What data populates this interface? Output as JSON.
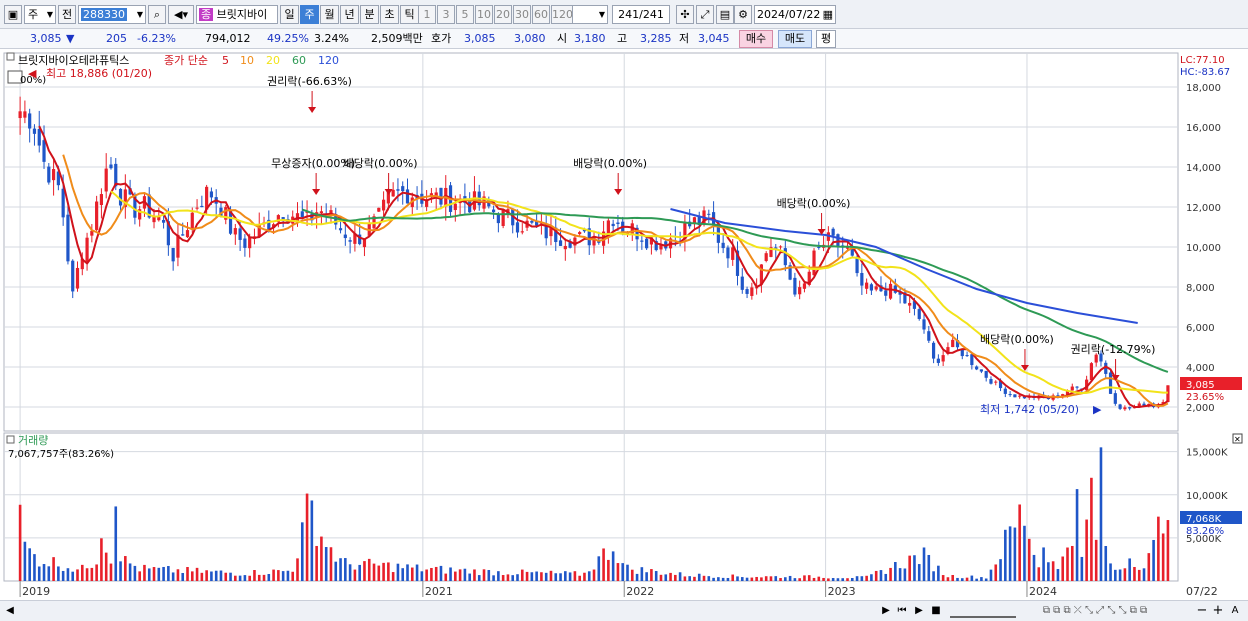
{
  "toolbar": {
    "market_label": "주",
    "prev_label": "전",
    "code": "288330",
    "stock_name": "브릿지바이",
    "periods": [
      "일",
      "주",
      "월",
      "년",
      "분",
      "초",
      "틱"
    ],
    "selected_period": "주",
    "intervals": [
      "1",
      "3",
      "5",
      "10",
      "20",
      "30",
      "60",
      "120"
    ],
    "count": "241",
    "count_total": "/241",
    "date": "2024/07/22"
  },
  "quote": {
    "price": "3,085",
    "change_arrow": "▼",
    "change": "205",
    "change_pct": "-6.23%",
    "volume": "794,012",
    "turnover_pct": "49.25%",
    "ratio": "3.24%",
    "amount": "2,509백만",
    "bid_label": "호가",
    "bid": "3,085",
    "ask": "3,080",
    "open_label": "시",
    "open": "3,180",
    "high_label": "고",
    "high": "3,285",
    "low_label": "저",
    "low": "3,045",
    "buy_button": "매수",
    "sell_button": "매도",
    "flat_button": "평"
  },
  "price_panel": {
    "stock_title": "브릿지바이오테라퓨틱스",
    "ma_title": "종가 단순",
    "ma_periods": [
      "5",
      "10",
      "20",
      "60",
      "120"
    ],
    "ma_colors": [
      "#d0121b",
      "#f08c1a",
      "#f2e31a",
      "#2e9a55",
      "#2b4fd8"
    ],
    "lc": "LC:77.10",
    "hc": "HC:-83.67",
    "high_label": "최고 18,886 (01/20)",
    "low_label": "최저 1,742 (05/20)",
    "current_price": "3,085",
    "current_pct": "23.65%",
    "partial_label": "00%)",
    "y_ticks": [
      "18,000",
      "16,000",
      "14,000",
      "12,000",
      "10,000",
      "8,000",
      "6,000",
      "4,000",
      "2,000"
    ],
    "events": [
      {
        "label": "권리락(-66.63%)",
        "date": "2020.45",
        "y": 16500
      },
      {
        "label": "무상증자(0.00%)",
        "date": "2020.47",
        "y": 12400
      },
      {
        "label": "배당락(0.00%)",
        "date": "2020.83",
        "y": 12400
      },
      {
        "label": "배당락(0.00%)",
        "date": "2021.97",
        "y": 12400
      },
      {
        "label": "배당락(0.00%)",
        "date": "2022.98",
        "y": 10400
      },
      {
        "label": "배당락(0.00%)",
        "date": "2023.99",
        "y": 3600
      },
      {
        "label": "권리락(-12.79%)",
        "date": "2024.44",
        "y": 3100
      }
    ]
  },
  "volume_panel": {
    "title": "거래량",
    "top_value": "7,067,757주(83.26%)",
    "current": "7,068K",
    "current_pct": "83.26%",
    "y_ticks": [
      "15,000K",
      "10,000K",
      "5,000K"
    ]
  },
  "x_axis": {
    "labels": [
      "2019",
      "2021",
      "2022",
      "2023",
      "2024",
      "07/22"
    ]
  },
  "chart_data": {
    "type": "candlestick",
    "interval": "weekly",
    "x_labels": [
      "2019",
      "2021",
      "2022",
      "2023",
      "2024",
      "07/22"
    ],
    "y_ticks": [
      18000,
      16000,
      14000,
      12000,
      10000,
      8000,
      6000,
      4000,
      2000
    ],
    "ylim": [
      1000,
      19500
    ],
    "ma": [
      5,
      10,
      20,
      60,
      120
    ],
    "annotations": [
      "최고 18,886 (01/20)",
      "최저 1,742 (05/20)"
    ],
    "close_anchors": [
      [
        2019.0,
        16800
      ],
      [
        2019.06,
        16500
      ],
      [
        2019.12,
        14200
      ],
      [
        2019.2,
        12800
      ],
      [
        2019.26,
        7500
      ],
      [
        2019.3,
        9600
      ],
      [
        2019.36,
        11200
      ],
      [
        2019.42,
        13800
      ],
      [
        2019.46,
        14000
      ],
      [
        2019.5,
        12600
      ],
      [
        2019.56,
        11900
      ],
      [
        2019.62,
        12000
      ],
      [
        2019.7,
        11400
      ],
      [
        2019.76,
        9600
      ],
      [
        2019.82,
        10900
      ],
      [
        2019.88,
        12200
      ],
      [
        2019.94,
        12800
      ],
      [
        2020.0,
        12000
      ],
      [
        2020.06,
        10600
      ],
      [
        2020.12,
        10200
      ],
      [
        2020.18,
        10800
      ],
      [
        2020.24,
        11300
      ],
      [
        2020.3,
        11800
      ],
      [
        2020.36,
        11600
      ],
      [
        2020.42,
        11200
      ],
      [
        2020.48,
        11900
      ],
      [
        2020.54,
        11500
      ],
      [
        2020.6,
        10800
      ],
      [
        2020.66,
        10400
      ],
      [
        2020.72,
        10700
      ],
      [
        2020.78,
        11400
      ],
      [
        2020.84,
        12500
      ],
      [
        2020.92,
        12800
      ],
      [
        2021.0,
        12500
      ],
      [
        2021.1,
        12400
      ],
      [
        2021.2,
        12300
      ],
      [
        2021.3,
        12100
      ],
      [
        2021.38,
        11600
      ],
      [
        2021.46,
        11300
      ],
      [
        2021.54,
        11000
      ],
      [
        2021.62,
        10700
      ],
      [
        2021.7,
        10500
      ],
      [
        2021.78,
        10400
      ],
      [
        2021.86,
        10500
      ],
      [
        2021.94,
        11600
      ],
      [
        2022.0,
        11000
      ],
      [
        2022.06,
        10800
      ],
      [
        2022.12,
        10400
      ],
      [
        2022.18,
        10200
      ],
      [
        2022.26,
        10600
      ],
      [
        2022.34,
        11200
      ],
      [
        2022.42,
        11400
      ],
      [
        2022.48,
        10200
      ],
      [
        2022.54,
        9600
      ],
      [
        2022.6,
        7800
      ],
      [
        2022.66,
        8400
      ],
      [
        2022.72,
        10200
      ],
      [
        2022.78,
        9600
      ],
      [
        2022.84,
        8000
      ],
      [
        2022.88,
        7600
      ],
      [
        2022.94,
        9400
      ],
      [
        2023.0,
        10300
      ],
      [
        2023.06,
        10100
      ],
      [
        2023.12,
        9800
      ],
      [
        2023.16,
        8200
      ],
      [
        2023.22,
        7700
      ],
      [
        2023.3,
        7900
      ],
      [
        2023.36,
        7600
      ],
      [
        2023.42,
        7000
      ],
      [
        2023.48,
        6200
      ],
      [
        2023.54,
        4200
      ],
      [
        2023.58,
        4600
      ],
      [
        2023.62,
        5200
      ],
      [
        2023.68,
        4700
      ],
      [
        2023.74,
        4100
      ],
      [
        2023.8,
        3500
      ],
      [
        2023.86,
        3000
      ],
      [
        2023.92,
        2600
      ],
      [
        2023.98,
        2500
      ],
      [
        2024.04,
        2500
      ],
      [
        2024.1,
        2400
      ],
      [
        2024.16,
        2600
      ],
      [
        2024.22,
        2900
      ],
      [
        2024.28,
        3000
      ],
      [
        2024.34,
        4800
      ],
      [
        2024.38,
        4100
      ],
      [
        2024.42,
        2500
      ],
      [
        2024.46,
        2000
      ],
      [
        2024.5,
        1900
      ],
      [
        2024.56,
        2100
      ],
      [
        2024.6,
        2200
      ],
      [
        2024.64,
        2000
      ],
      [
        2024.68,
        2400
      ],
      [
        2024.7,
        3085
      ]
    ],
    "ma120_anchors": [
      [
        2022.23,
        11900
      ],
      [
        2022.5,
        11200
      ],
      [
        2022.8,
        10800
      ],
      [
        2023.0,
        10600
      ],
      [
        2023.25,
        10000
      ],
      [
        2023.5,
        8900
      ],
      [
        2023.75,
        7900
      ],
      [
        2024.0,
        7200
      ],
      [
        2024.25,
        6700
      ],
      [
        2024.55,
        6200
      ]
    ],
    "volume_anchors_k": [
      [
        2019.0,
        7000
      ],
      [
        2019.03,
        3500
      ],
      [
        2019.1,
        2500
      ],
      [
        2019.2,
        2000
      ],
      [
        2019.3,
        1200
      ],
      [
        2019.4,
        3000
      ],
      [
        2019.41,
        14000
      ],
      [
        2019.43,
        3000
      ],
      [
        2019.45,
        1500
      ],
      [
        2019.47,
        15500
      ],
      [
        2019.5,
        2500
      ],
      [
        2019.6,
        1400
      ],
      [
        2019.8,
        1200
      ],
      [
        2020.1,
        900
      ],
      [
        2020.35,
        1200
      ],
      [
        2020.44,
        8800
      ],
      [
        2020.5,
        5000
      ],
      [
        2020.6,
        2000
      ],
      [
        2020.8,
        1800
      ],
      [
        2021.0,
        1400
      ],
      [
        2021.4,
        1000
      ],
      [
        2021.8,
        800
      ],
      [
        2021.95,
        4200
      ],
      [
        2022.0,
        1500
      ],
      [
        2022.3,
        700
      ],
      [
        2022.6,
        500
      ],
      [
        2022.9,
        500
      ],
      [
        2023.2,
        400
      ],
      [
        2023.48,
        3000
      ],
      [
        2023.6,
        600
      ],
      [
        2023.8,
        400
      ],
      [
        2023.98,
        8200
      ],
      [
        2024.06,
        1500
      ],
      [
        2024.08,
        4800
      ],
      [
        2024.15,
        900
      ],
      [
        2024.25,
        8500
      ],
      [
        2024.27,
        2000
      ],
      [
        2024.32,
        10500
      ],
      [
        2024.34,
        3500
      ],
      [
        2024.36,
        13500
      ],
      [
        2024.4,
        2000
      ],
      [
        2024.45,
        1200
      ],
      [
        2024.52,
        3000
      ],
      [
        2024.58,
        1500
      ],
      [
        2024.64,
        4200
      ],
      [
        2024.67,
        8500
      ],
      [
        2024.7,
        7068
      ]
    ]
  }
}
